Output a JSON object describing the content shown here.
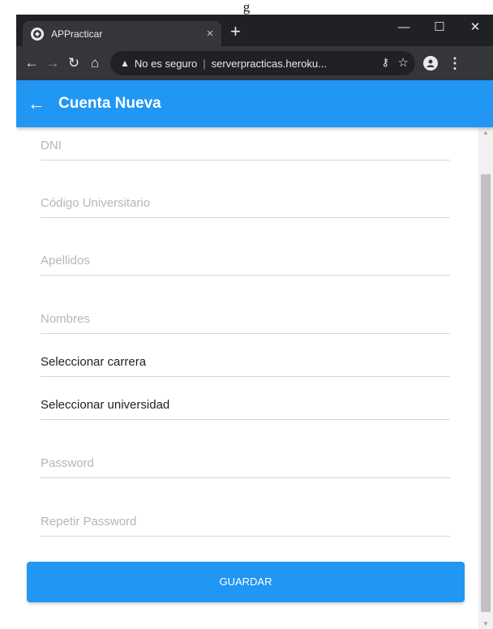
{
  "caption": "g",
  "browser": {
    "tab_title": "APPracticar",
    "tab_close": "×",
    "new_tab": "+",
    "window_min": "—",
    "window_max": "☐",
    "window_close": "✕",
    "security_label": "No es seguro",
    "separator": "|",
    "url": "serverpracticas.heroku...",
    "icons": [
      "globe-icon",
      "back-arrow-icon",
      "forward-arrow-icon",
      "reload-icon",
      "home-icon",
      "warning-icon",
      "key-icon",
      "star-icon",
      "profile-icon",
      "menu-icon"
    ]
  },
  "app": {
    "title": "Cuenta Nueva",
    "accent": "#2196f3"
  },
  "form": {
    "fields": [
      {
        "placeholder": "DNI"
      },
      {
        "placeholder": "Código Universitario"
      },
      {
        "placeholder": "Apellidos"
      },
      {
        "placeholder": "Nombres"
      },
      {
        "value": "Seleccionar carrera"
      },
      {
        "value": "Seleccionar universidad"
      },
      {
        "placeholder": "Password"
      },
      {
        "placeholder": "Repetir Password"
      }
    ],
    "save_label": "GUARDAR"
  }
}
